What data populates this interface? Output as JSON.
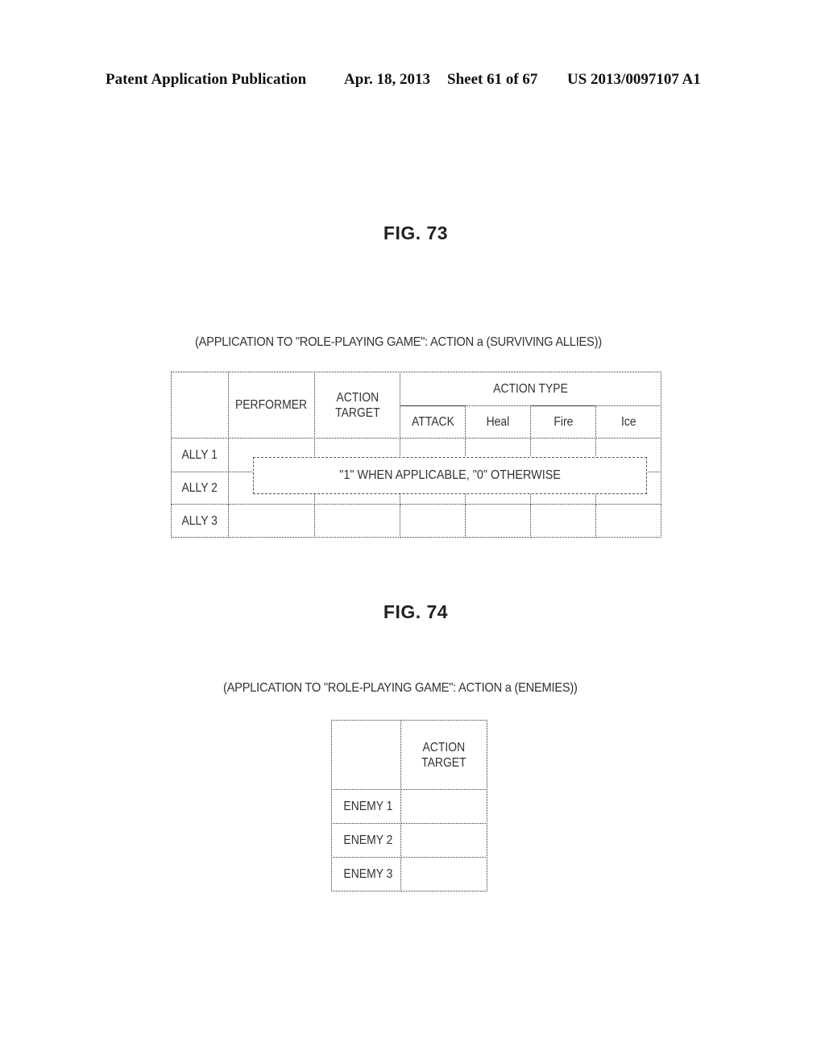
{
  "header": {
    "publication_type": "Patent Application Publication",
    "date": "Apr. 18, 2013",
    "sheet": "Sheet 61 of 67",
    "patent_number": "US 2013/0097107 A1"
  },
  "fig73": {
    "title": "FIG. 73",
    "caption": "(APPLICATION TO \"ROLE-PLAYING GAME\": ACTION a (SURVIVING ALLIES))",
    "columns": {
      "performer": "PERFORMER",
      "action_target": "ACTION\nTARGET",
      "action_type": "ACTION TYPE",
      "action_types": [
        "ATTACK",
        "Heal",
        "Fire",
        "Ice"
      ]
    },
    "rows": [
      "ALLY 1",
      "ALLY 2",
      "ALLY 3"
    ],
    "note": "\"1\" WHEN APPLICABLE, \"0\" OTHERWISE"
  },
  "fig74": {
    "title": "FIG. 74",
    "caption": "(APPLICATION TO \"ROLE-PLAYING GAME\": ACTION a (ENEMIES))",
    "columns": {
      "action_target": "ACTION\nTARGET"
    },
    "rows": [
      "ENEMY 1",
      "ENEMY 2",
      "ENEMY 3"
    ]
  }
}
